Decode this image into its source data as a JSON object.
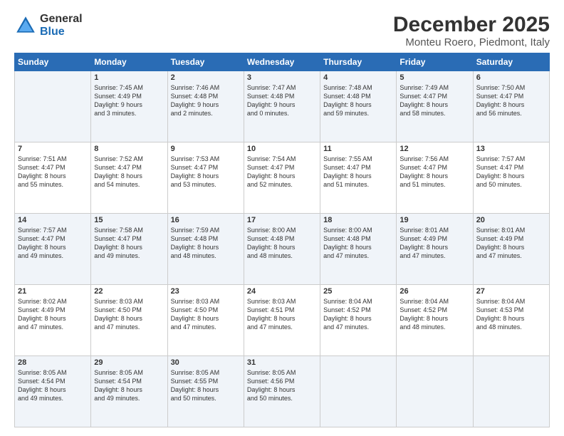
{
  "logo": {
    "general": "General",
    "blue": "Blue"
  },
  "title": "December 2025",
  "subtitle": "Monteu Roero, Piedmont, Italy",
  "days_header": [
    "Sunday",
    "Monday",
    "Tuesday",
    "Wednesday",
    "Thursday",
    "Friday",
    "Saturday"
  ],
  "weeks": [
    [
      {
        "num": "",
        "info": ""
      },
      {
        "num": "1",
        "info": "Sunrise: 7:45 AM\nSunset: 4:49 PM\nDaylight: 9 hours\nand 3 minutes."
      },
      {
        "num": "2",
        "info": "Sunrise: 7:46 AM\nSunset: 4:48 PM\nDaylight: 9 hours\nand 2 minutes."
      },
      {
        "num": "3",
        "info": "Sunrise: 7:47 AM\nSunset: 4:48 PM\nDaylight: 9 hours\nand 0 minutes."
      },
      {
        "num": "4",
        "info": "Sunrise: 7:48 AM\nSunset: 4:48 PM\nDaylight: 8 hours\nand 59 minutes."
      },
      {
        "num": "5",
        "info": "Sunrise: 7:49 AM\nSunset: 4:47 PM\nDaylight: 8 hours\nand 58 minutes."
      },
      {
        "num": "6",
        "info": "Sunrise: 7:50 AM\nSunset: 4:47 PM\nDaylight: 8 hours\nand 56 minutes."
      }
    ],
    [
      {
        "num": "7",
        "info": "Sunrise: 7:51 AM\nSunset: 4:47 PM\nDaylight: 8 hours\nand 55 minutes."
      },
      {
        "num": "8",
        "info": "Sunrise: 7:52 AM\nSunset: 4:47 PM\nDaylight: 8 hours\nand 54 minutes."
      },
      {
        "num": "9",
        "info": "Sunrise: 7:53 AM\nSunset: 4:47 PM\nDaylight: 8 hours\nand 53 minutes."
      },
      {
        "num": "10",
        "info": "Sunrise: 7:54 AM\nSunset: 4:47 PM\nDaylight: 8 hours\nand 52 minutes."
      },
      {
        "num": "11",
        "info": "Sunrise: 7:55 AM\nSunset: 4:47 PM\nDaylight: 8 hours\nand 51 minutes."
      },
      {
        "num": "12",
        "info": "Sunrise: 7:56 AM\nSunset: 4:47 PM\nDaylight: 8 hours\nand 51 minutes."
      },
      {
        "num": "13",
        "info": "Sunrise: 7:57 AM\nSunset: 4:47 PM\nDaylight: 8 hours\nand 50 minutes."
      }
    ],
    [
      {
        "num": "14",
        "info": "Sunrise: 7:57 AM\nSunset: 4:47 PM\nDaylight: 8 hours\nand 49 minutes."
      },
      {
        "num": "15",
        "info": "Sunrise: 7:58 AM\nSunset: 4:47 PM\nDaylight: 8 hours\nand 49 minutes."
      },
      {
        "num": "16",
        "info": "Sunrise: 7:59 AM\nSunset: 4:48 PM\nDaylight: 8 hours\nand 48 minutes."
      },
      {
        "num": "17",
        "info": "Sunrise: 8:00 AM\nSunset: 4:48 PM\nDaylight: 8 hours\nand 48 minutes."
      },
      {
        "num": "18",
        "info": "Sunrise: 8:00 AM\nSunset: 4:48 PM\nDaylight: 8 hours\nand 47 minutes."
      },
      {
        "num": "19",
        "info": "Sunrise: 8:01 AM\nSunset: 4:49 PM\nDaylight: 8 hours\nand 47 minutes."
      },
      {
        "num": "20",
        "info": "Sunrise: 8:01 AM\nSunset: 4:49 PM\nDaylight: 8 hours\nand 47 minutes."
      }
    ],
    [
      {
        "num": "21",
        "info": "Sunrise: 8:02 AM\nSunset: 4:49 PM\nDaylight: 8 hours\nand 47 minutes."
      },
      {
        "num": "22",
        "info": "Sunrise: 8:03 AM\nSunset: 4:50 PM\nDaylight: 8 hours\nand 47 minutes."
      },
      {
        "num": "23",
        "info": "Sunrise: 8:03 AM\nSunset: 4:50 PM\nDaylight: 8 hours\nand 47 minutes."
      },
      {
        "num": "24",
        "info": "Sunrise: 8:03 AM\nSunset: 4:51 PM\nDaylight: 8 hours\nand 47 minutes."
      },
      {
        "num": "25",
        "info": "Sunrise: 8:04 AM\nSunset: 4:52 PM\nDaylight: 8 hours\nand 47 minutes."
      },
      {
        "num": "26",
        "info": "Sunrise: 8:04 AM\nSunset: 4:52 PM\nDaylight: 8 hours\nand 48 minutes."
      },
      {
        "num": "27",
        "info": "Sunrise: 8:04 AM\nSunset: 4:53 PM\nDaylight: 8 hours\nand 48 minutes."
      }
    ],
    [
      {
        "num": "28",
        "info": "Sunrise: 8:05 AM\nSunset: 4:54 PM\nDaylight: 8 hours\nand 49 minutes."
      },
      {
        "num": "29",
        "info": "Sunrise: 8:05 AM\nSunset: 4:54 PM\nDaylight: 8 hours\nand 49 minutes."
      },
      {
        "num": "30",
        "info": "Sunrise: 8:05 AM\nSunset: 4:55 PM\nDaylight: 8 hours\nand 50 minutes."
      },
      {
        "num": "31",
        "info": "Sunrise: 8:05 AM\nSunset: 4:56 PM\nDaylight: 8 hours\nand 50 minutes."
      },
      {
        "num": "",
        "info": ""
      },
      {
        "num": "",
        "info": ""
      },
      {
        "num": "",
        "info": ""
      }
    ]
  ]
}
